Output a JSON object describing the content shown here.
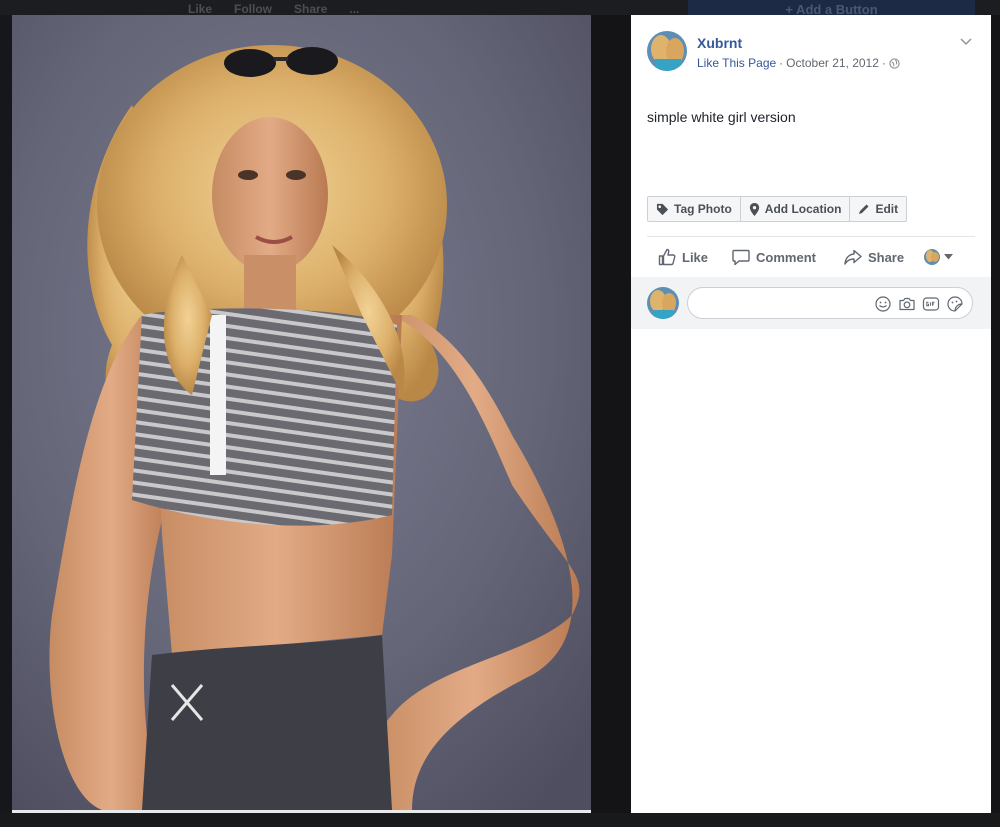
{
  "background_page": {
    "actions": [
      "Like",
      "Follow",
      "Share",
      "..."
    ],
    "cta_label": "+ Add a Button"
  },
  "post": {
    "page_name": "Xubrnt",
    "like_page_label": "Like This Page",
    "date": "October 21, 2012",
    "separator": "·",
    "caption": "simple white girl version"
  },
  "photo_actions": {
    "tag_photo": "Tag Photo",
    "add_location": "Add Location",
    "edit": "Edit"
  },
  "ufi": {
    "like": "Like",
    "comment": "Comment",
    "share": "Share"
  },
  "comment_box": {
    "placeholder": ""
  },
  "icons": {
    "audience": "globe-icon",
    "tag": "tag-icon",
    "location": "location-pin-icon",
    "edit": "pencil-icon",
    "like": "thumbs-up-icon",
    "comment": "speech-bubble-icon",
    "share": "share-arrow-icon",
    "emoji": "smiley-icon",
    "camera": "camera-icon",
    "gif": "gif-icon",
    "sticker": "sticker-icon"
  },
  "colors": {
    "link_blue": "#365899",
    "panel_bg": "#ffffff",
    "theater_bg": "#0b0b0c",
    "photo_backdrop": "#6e6e82"
  }
}
